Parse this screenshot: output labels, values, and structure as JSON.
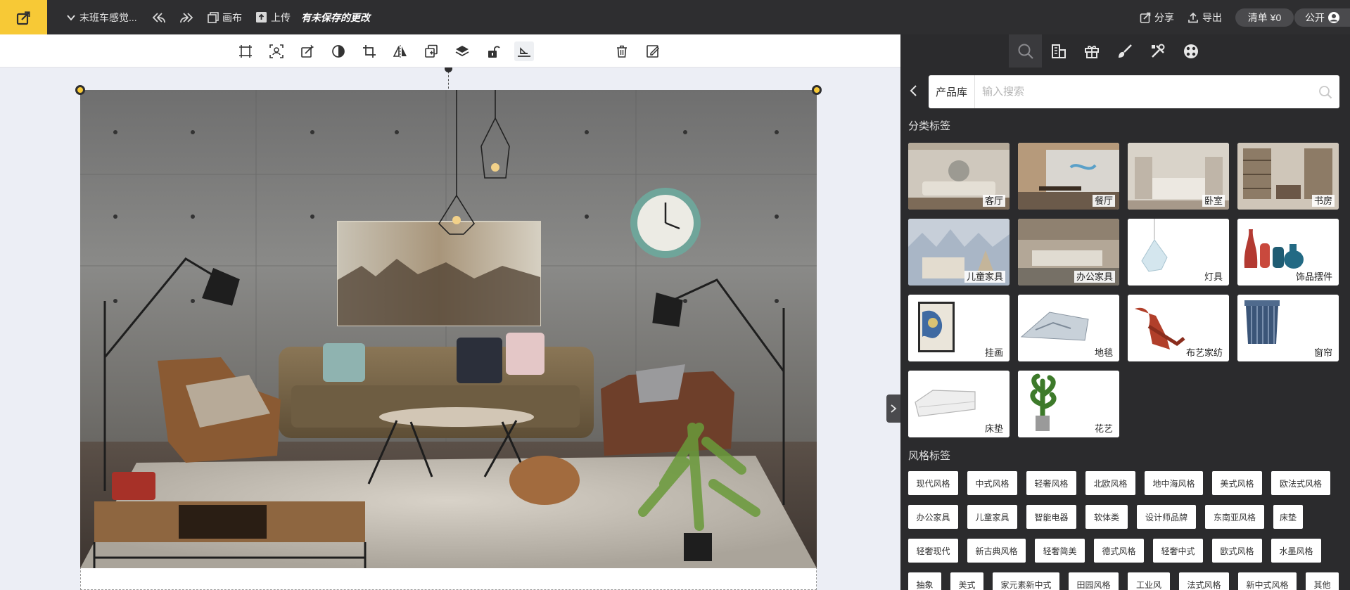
{
  "topbar": {
    "project_title": "末班车感觉...",
    "canvas_label": "画布",
    "upload_label": "上传",
    "unsaved_label": "有未保存的更改",
    "share_label": "分享",
    "export_label": "导出",
    "cart_label": "清单 ¥0",
    "visibility_label": "公开"
  },
  "colors": {
    "accent": "#f7c936",
    "topbar_bg": "#2e2e30",
    "panel_bg": "#2b2b2d"
  },
  "toolbar": {
    "tools": [
      "select-frame-icon",
      "cutout-icon",
      "magic-edit-icon",
      "contrast-icon",
      "crop-icon",
      "flip-icon",
      "duplicate-icon",
      "layers-icon",
      "lock-icon",
      "align-bottom-icon",
      "delete-icon",
      "edit-note-icon"
    ]
  },
  "panel": {
    "tabs": [
      "search-icon",
      "building-icon",
      "gift-icon",
      "brush-icon",
      "tools-icon",
      "palette-icon"
    ],
    "search_scope": "产品库",
    "search_placeholder": "输入搜索",
    "category_title": "分类标签",
    "categories": [
      "客厅",
      "餐厅",
      "卧室",
      "书房",
      "儿童家具",
      "办公家具",
      "灯具",
      "饰品摆件",
      "挂画",
      "地毯",
      "布艺家纺",
      "窗帘",
      "床垫",
      "花艺"
    ],
    "style_title": "风格标签",
    "styles": [
      [
        "现代风格",
        "中式风格",
        "轻奢风格",
        "北欧风格",
        "地中海风格",
        "美式风格",
        "欧法式风格"
      ],
      [
        "办公家具",
        "儿童家具",
        "智能电器",
        "软体类",
        "设计师品牌",
        "东南亚风格",
        "床垫"
      ],
      [
        "轻奢现代",
        "新古典风格",
        "轻奢简美",
        "德式风格",
        "轻奢中式",
        "欧式风格",
        "水墨风格"
      ],
      [
        "抽象",
        "美式",
        "家元素新中式",
        "田园风格",
        "工业风",
        "法式风格",
        "新中式风格",
        "其他"
      ]
    ]
  }
}
